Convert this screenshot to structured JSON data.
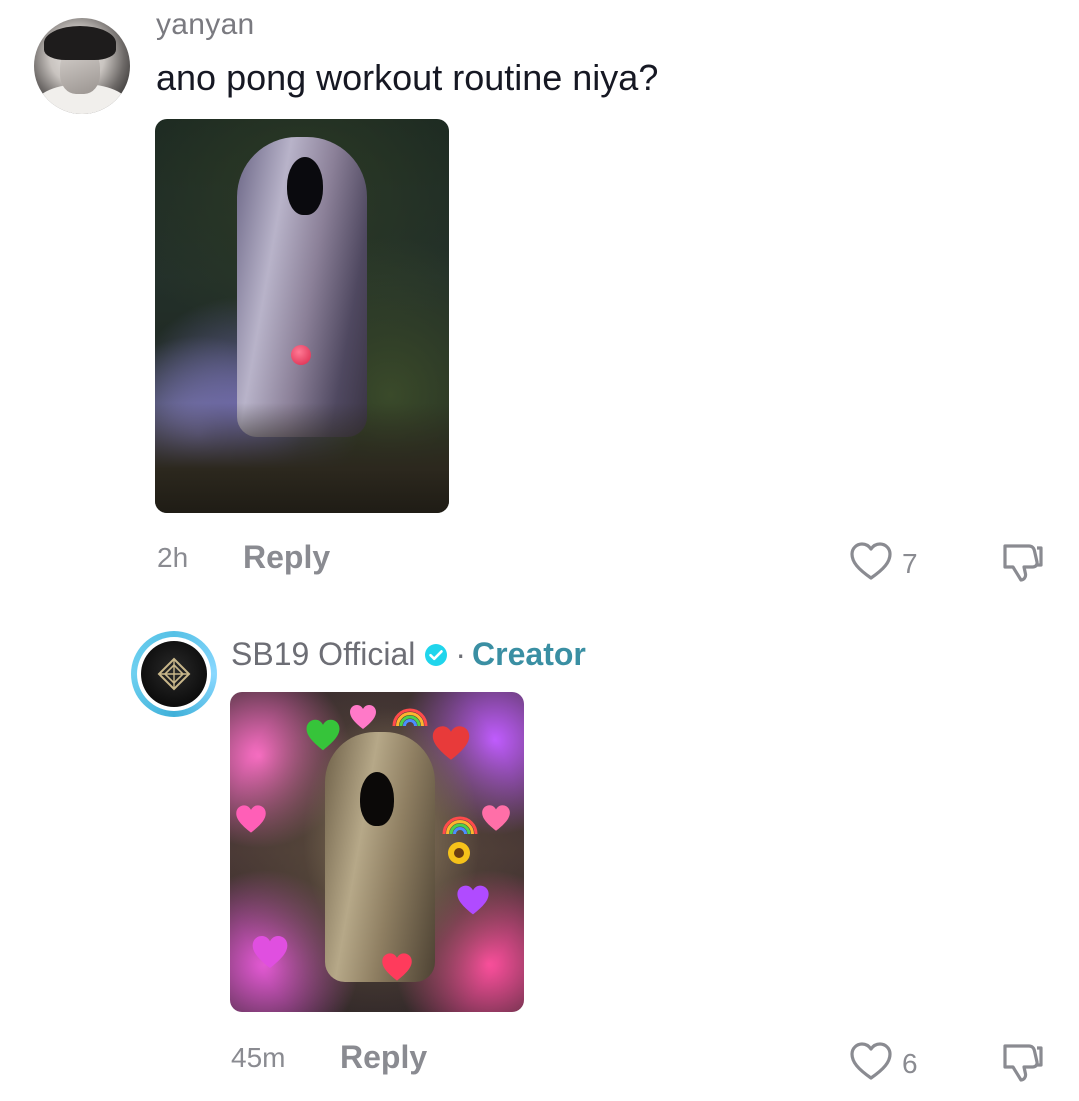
{
  "comments": [
    {
      "username": "yanyan",
      "text": "ano pong workout routine niya?",
      "time": "2h",
      "reply_label": "Reply",
      "like_count": "7",
      "avatar_icon": "user-avatar",
      "attachment": "statue-photo"
    },
    {
      "username": "SB19 Official",
      "verified": true,
      "separator": "·",
      "creator_label": "Creator",
      "time": "45m",
      "reply_label": "Reply",
      "like_count": "6",
      "avatar_icon": "sb19-logo",
      "attachment": "statue-hearts-photo"
    }
  ],
  "colors": {
    "secondary_text": "#8a8b91",
    "creator_accent": "#3a8fa3",
    "verified_blue": "#20d5ec",
    "ring_blue": "#56c1e6"
  }
}
